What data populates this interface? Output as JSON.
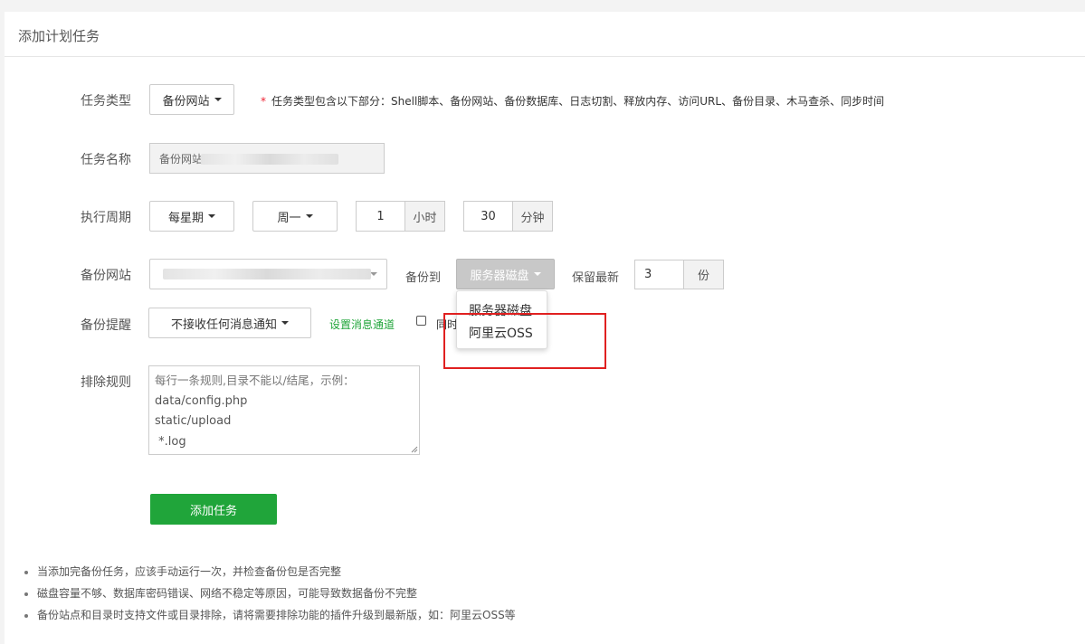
{
  "panel": {
    "title": "添加计划任务"
  },
  "task_type": {
    "label": "任务类型",
    "value": "备份网站",
    "note_star": "*",
    "note": "任务类型包含以下部分：Shell脚本、备份网站、备份数据库、日志切割、释放内存、访问URL、备份目录、木马查杀、同步时间"
  },
  "task_name": {
    "label": "任务名称",
    "value": "备份网站"
  },
  "period": {
    "label": "执行周期",
    "cycle": "每星期",
    "weekday": "周一",
    "hour": "1",
    "hour_unit": "小时",
    "minute": "30",
    "minute_unit": "分钟"
  },
  "backup": {
    "label": "备份网站",
    "to_label": "备份到",
    "target": "服务器磁盘",
    "keep_label": "保留最新",
    "keep_count": "3",
    "keep_unit": "份"
  },
  "dropdown": {
    "options": [
      "服务器磁盘",
      "阿里云OSS"
    ]
  },
  "notify": {
    "label": "备份提醒",
    "value": "不接收任何消息通知",
    "link": "设置消息通道",
    "checkbox_label": "同时"
  },
  "exclude": {
    "label": "排除规则",
    "placeholder": "每行一条规则,目录不能以/结尾，示例：",
    "lines": [
      "data/config.php",
      "static/upload",
      " *.log"
    ]
  },
  "submit": {
    "label": "添加任务"
  },
  "tips": [
    "当添加完备份任务，应该手动运行一次，并检查备份包是否完整",
    "磁盘容量不够、数据库密码错误、网络不稳定等原因，可能导致数据备份不完整",
    "备份站点和目录时支持文件或目录排除，请将需要排除功能的插件升级到最新版，如：阿里云OSS等"
  ],
  "colors": {
    "accent_green": "#20a53a",
    "highlight_red": "#e02020"
  }
}
